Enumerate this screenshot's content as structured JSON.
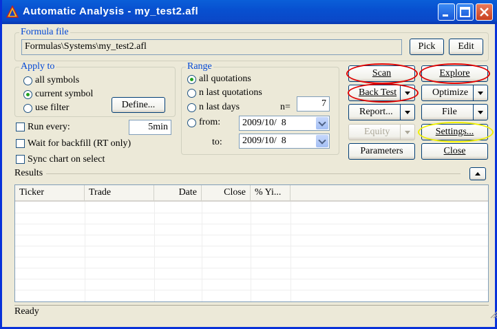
{
  "window": {
    "title": "Automatic Analysis - my_test2.afl"
  },
  "formula": {
    "group_label": "Formula file",
    "path": "Formulas\\Systems\\my_test2.afl",
    "pick_label": "Pick",
    "edit_label": "Edit"
  },
  "apply_to": {
    "group_label": "Apply to",
    "all_symbols": "all symbols",
    "current_symbol": "current symbol",
    "use_filter": "use filter",
    "define_label": "Define..."
  },
  "range": {
    "group_label": "Range",
    "all_quotations": "all quotations",
    "n_last_quotations": "n last quotations",
    "n_last_days": "n last days",
    "n_label": "n=",
    "n_value": "7",
    "from_label": "from:",
    "from_value": "2009/10/  8",
    "to_label": "to:",
    "to_value": "2009/10/  8"
  },
  "options": {
    "run_every": "Run every:",
    "run_every_value": "5min",
    "wait_backfill": "Wait for backfill (RT only)",
    "sync_chart": "Sync chart on select"
  },
  "buttons": {
    "scan": "Scan",
    "explore": "Explore",
    "back_test": "Back Test",
    "optimize": "Optimize",
    "report": "Report...",
    "file": "File",
    "equity": "Equity",
    "settings": "Settings...",
    "parameters": "Parameters",
    "close": "Close"
  },
  "results": {
    "label": "Results",
    "columns": [
      "Ticker",
      "Trade",
      "Date",
      "Close",
      "% Yi..."
    ]
  },
  "status": {
    "text": "Ready"
  },
  "colors": {
    "titlebar": "#0a5fd8",
    "group_label": "#0046d5",
    "highlight_red": "#e00000",
    "highlight_yellow": "#f0f000"
  }
}
